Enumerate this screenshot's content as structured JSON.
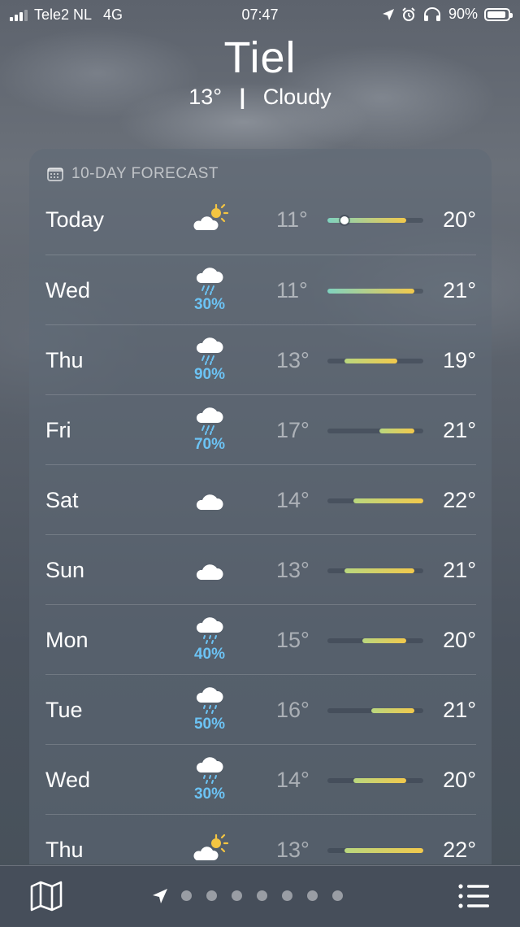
{
  "status_bar": {
    "carrier": "Tele2 NL",
    "network": "4G",
    "time": "07:47",
    "battery": "90%"
  },
  "header": {
    "city": "Tiel",
    "temperature": "13°",
    "separator": "|",
    "condition": "Cloudy"
  },
  "forecast": {
    "title": "10-DAY FORECAST",
    "scale_min": 11,
    "scale_max": 22,
    "days": [
      {
        "day": "Today",
        "icon": "partly-sunny-icon",
        "precip": "",
        "low": "11°",
        "high": "20°",
        "low_val": 11,
        "high_val": 20,
        "current": 13
      },
      {
        "day": "Wed",
        "icon": "rain-icon",
        "precip": "30%",
        "low": "11°",
        "high": "21°",
        "low_val": 11,
        "high_val": 21
      },
      {
        "day": "Thu",
        "icon": "rain-icon",
        "precip": "90%",
        "low": "13°",
        "high": "19°",
        "low_val": 13,
        "high_val": 19
      },
      {
        "day": "Fri",
        "icon": "rain-icon",
        "precip": "70%",
        "low": "17°",
        "high": "21°",
        "low_val": 17,
        "high_val": 21
      },
      {
        "day": "Sat",
        "icon": "cloud-icon",
        "precip": "",
        "low": "14°",
        "high": "22°",
        "low_val": 14,
        "high_val": 22
      },
      {
        "day": "Sun",
        "icon": "cloud-icon",
        "precip": "",
        "low": "13°",
        "high": "21°",
        "low_val": 13,
        "high_val": 21
      },
      {
        "day": "Mon",
        "icon": "drizzle-icon",
        "precip": "40%",
        "low": "15°",
        "high": "20°",
        "low_val": 15,
        "high_val": 20
      },
      {
        "day": "Tue",
        "icon": "drizzle-icon",
        "precip": "50%",
        "low": "16°",
        "high": "21°",
        "low_val": 16,
        "high_val": 21
      },
      {
        "day": "Wed",
        "icon": "drizzle-icon",
        "precip": "30%",
        "low": "14°",
        "high": "20°",
        "low_val": 14,
        "high_val": 20
      },
      {
        "day": "Thu",
        "icon": "partly-sunny-icon",
        "precip": "",
        "low": "13°",
        "high": "22°",
        "low_val": 13,
        "high_val": 22
      }
    ]
  },
  "bottom_bar": {
    "map_icon": "map-icon",
    "location_icon": "location-arrow-icon",
    "page_count": 7,
    "list_icon": "list-icon"
  },
  "colors": {
    "precip": "#6cc3f4",
    "cool": "#7fd3c0",
    "mild": "#b9d77f",
    "warm": "#f2c94c"
  }
}
